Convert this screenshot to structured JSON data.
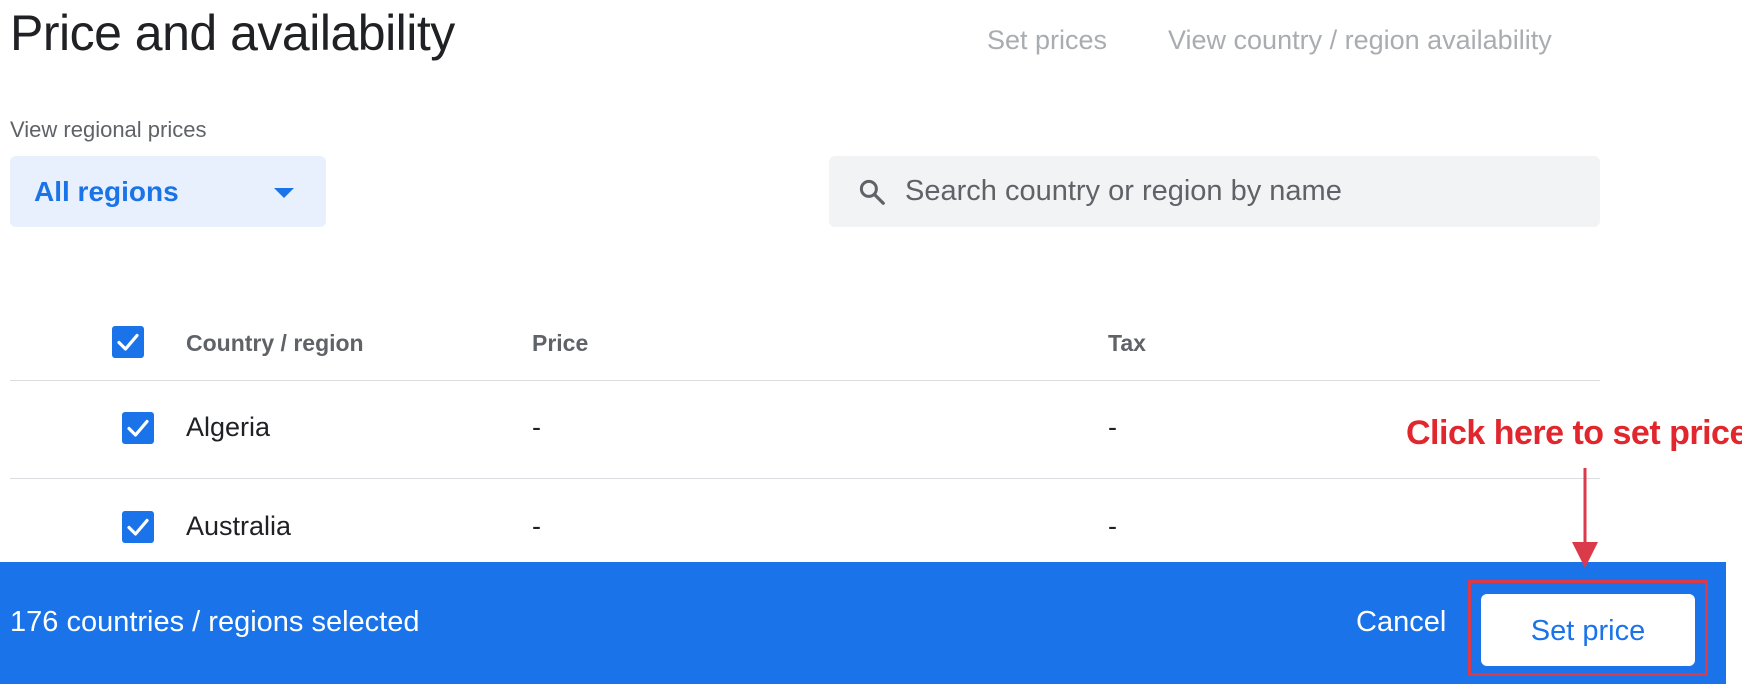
{
  "page": {
    "title": "Price and availability"
  },
  "top_links": {
    "set_prices": "Set prices",
    "availability": "View country / region availability"
  },
  "filter": {
    "label": "View regional prices",
    "selected": "All regions",
    "arrow_icon": "dropdown-arrow-icon"
  },
  "search": {
    "placeholder": "Search country or region by name",
    "value": "",
    "icon": "search-icon"
  },
  "table": {
    "headers": {
      "country": "Country / region",
      "price": "Price",
      "tax": "Tax"
    },
    "header_checked": true,
    "rows": [
      {
        "country": "Algeria",
        "price": "-",
        "tax": "-",
        "checked": true
      },
      {
        "country": "Australia",
        "price": "-",
        "tax": "-",
        "checked": true
      }
    ]
  },
  "action_bar": {
    "selected_text": "176 countries / regions selected",
    "cancel_label": "Cancel",
    "set_price_label": "Set price"
  },
  "annotation": {
    "text": "Click here to set price"
  },
  "colors": {
    "brand_blue": "#1a73e8",
    "annotation_red": "#e1262d"
  }
}
